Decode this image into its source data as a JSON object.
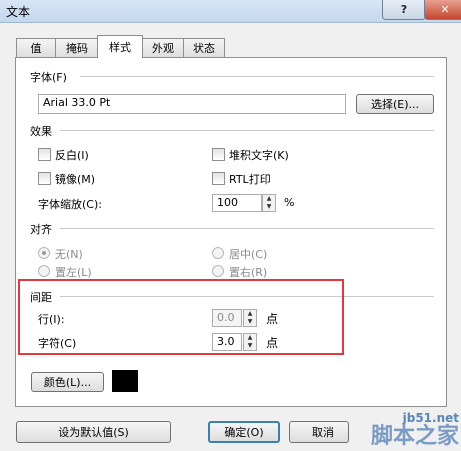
{
  "window": {
    "title": "文本",
    "help": "?",
    "close": "✕"
  },
  "tabs": [
    {
      "label": "值"
    },
    {
      "label": "掩码"
    },
    {
      "label": "样式"
    },
    {
      "label": "外观"
    },
    {
      "label": "状态"
    }
  ],
  "font": {
    "heading": "字体(F)",
    "value": "Arial 33.0 Pt",
    "select_label": "选择(E)..."
  },
  "effects": {
    "heading": "效果",
    "invert": "反白(I)",
    "stack": "堆积文字(K)",
    "mirror": "镜像(M)",
    "rtl": "RTL打印",
    "scale_label": "字体缩放(C):",
    "scale_value": "100",
    "scale_unit": "%"
  },
  "align": {
    "heading": "对齐",
    "none": "无(N)",
    "center": "居中(C)",
    "left": "置左(L)",
    "right": "置右(R)"
  },
  "spacing": {
    "heading": "间距",
    "line_label": "行(I):",
    "line_value": "0.0",
    "line_unit": "点",
    "char_label": "字符(C)",
    "char_value": "3.0",
    "char_unit": "点"
  },
  "color": {
    "button": "颜色(L)...",
    "swatch": "#000000"
  },
  "footer": {
    "default_btn": "设为默认值(S)",
    "ok_btn": "确定(O)",
    "cancel_btn": "取消"
  },
  "watermark": {
    "site": "jb51.net",
    "brand": "脚本之家"
  },
  "colors": {
    "highlight": "#e0393e",
    "accent": "#3c7fb1"
  }
}
